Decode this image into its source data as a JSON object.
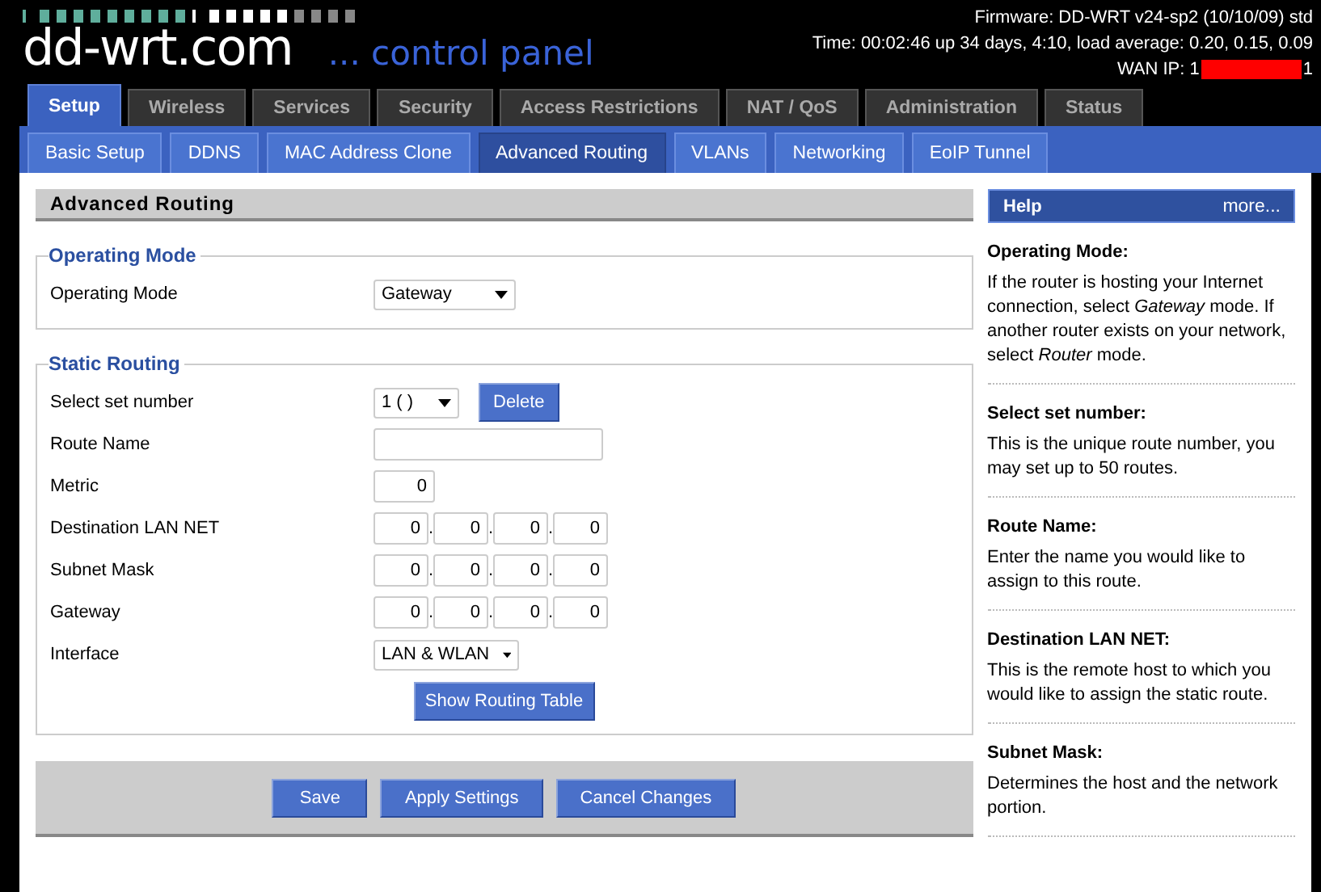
{
  "header": {
    "logo": "dd-wrt.com",
    "tagline": "... control panel",
    "firmware": "Firmware: DD-WRT v24-sp2 (10/10/09) std",
    "time": "Time: 00:02:46 up 34 days, 4:10, load average: 0.20, 0.15, 0.09",
    "wan_ip_prefix": "WAN IP: 1",
    "wan_ip_suffix": "1"
  },
  "tabs": [
    {
      "label": "Setup",
      "selected": true
    },
    {
      "label": "Wireless",
      "selected": false
    },
    {
      "label": "Services",
      "selected": false
    },
    {
      "label": "Security",
      "selected": false
    },
    {
      "label": "Access Restrictions",
      "selected": false
    },
    {
      "label": "NAT / QoS",
      "selected": false
    },
    {
      "label": "Administration",
      "selected": false
    },
    {
      "label": "Status",
      "selected": false
    }
  ],
  "subtabs": [
    {
      "label": "Basic Setup",
      "selected": false
    },
    {
      "label": "DDNS",
      "selected": false
    },
    {
      "label": "MAC Address Clone",
      "selected": false
    },
    {
      "label": "Advanced Routing",
      "selected": true
    },
    {
      "label": "VLANs",
      "selected": false
    },
    {
      "label": "Networking",
      "selected": false
    },
    {
      "label": "EoIP Tunnel",
      "selected": false
    }
  ],
  "page_title": "Advanced Routing",
  "sections": [
    {
      "legend": "Operating Mode",
      "rows": [
        {
          "kind": "select",
          "label": "Operating Mode",
          "value": "Gateway"
        }
      ]
    },
    {
      "legend": "Static Routing",
      "rows": [
        {
          "kind": "select_button",
          "label": "Select set number",
          "value": "1 ( )",
          "button": "Delete"
        },
        {
          "kind": "text",
          "label": "Route Name",
          "value": ""
        },
        {
          "kind": "number",
          "label": "Metric",
          "value": "0"
        },
        {
          "kind": "ip",
          "label": "Destination LAN NET",
          "octets": [
            "0",
            "0",
            "0",
            "0"
          ],
          "separators": [
            ".",
            ".",
            "."
          ]
        },
        {
          "kind": "ip",
          "label": "Subnet Mask",
          "octets": [
            "0",
            "0",
            "0",
            "0"
          ],
          "separators": [
            ".",
            ".",
            "."
          ]
        },
        {
          "kind": "ip",
          "label": "Gateway",
          "octets": [
            "0",
            "0",
            "0",
            "0"
          ],
          "separators": [
            ".",
            ".",
            "."
          ]
        },
        {
          "kind": "select",
          "label": "Interface",
          "value": "LAN & WLAN"
        },
        {
          "kind": "button",
          "button": "Show Routing Table"
        }
      ]
    }
  ],
  "footer_buttons": [
    "Save",
    "Apply Settings",
    "Cancel Changes"
  ],
  "help": {
    "title": "Help",
    "more": "more...",
    "entries": [
      {
        "heading": "Operating Mode:",
        "text": "If the router is hosting your Internet connection, select *Gateway* mode. If another router exists on your network, select *Router* mode."
      },
      {
        "heading": "Select set number:",
        "text": "This is the unique route number, you may set up to 50 routes."
      },
      {
        "heading": "Route Name:",
        "text": "Enter the name you would like to assign to this route."
      },
      {
        "heading": "Destination LAN NET:",
        "text": "This is the remote host to which you would like to assign the static route."
      },
      {
        "heading": "Subnet Mask:",
        "text": "Determines the host and the network portion."
      }
    ]
  }
}
